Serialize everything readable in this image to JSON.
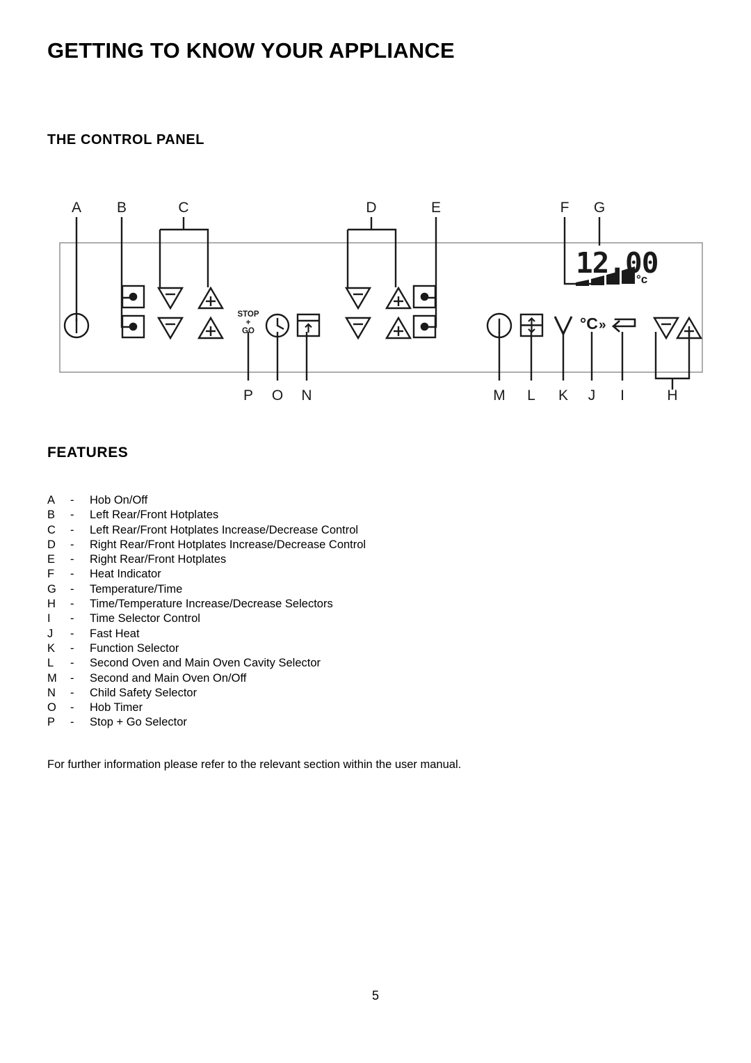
{
  "document": {
    "page_title": "GETTING TO KNOW YOUR APPLIANCE",
    "section_title": "THE CONTROL PANEL",
    "features_title": "FEATURES",
    "footnote": "For further information please refer to the relevant section within the user manual.",
    "page_number": "5"
  },
  "diagram": {
    "top_labels": [
      {
        "letter": "A"
      },
      {
        "letter": "B"
      },
      {
        "letter": "C"
      },
      {
        "letter": "D"
      },
      {
        "letter": "E"
      },
      {
        "letter": "F"
      },
      {
        "letter": "G"
      }
    ],
    "bottom_labels": [
      {
        "letter": "P"
      },
      {
        "letter": "O"
      },
      {
        "letter": "N"
      },
      {
        "letter": "M"
      },
      {
        "letter": "L"
      },
      {
        "letter": "K"
      },
      {
        "letter": "J"
      },
      {
        "letter": "I"
      },
      {
        "letter": "H"
      }
    ],
    "display": {
      "readout": "12.00",
      "unit": "°c",
      "heat_bars": 4
    },
    "stop_go": {
      "line1": "STOP",
      "line2": "+",
      "line3": "GO"
    },
    "symbols": [
      {
        "name": "hob-power-icon",
        "meaning": "Hob On/Off"
      },
      {
        "name": "hotplate-rear-icon",
        "meaning": "Left Rear Hotplate"
      },
      {
        "name": "hotplate-front-icon",
        "meaning": "Left Front Hotplate"
      },
      {
        "name": "decrease-triangle-icon",
        "meaning": "Decrease"
      },
      {
        "name": "increase-triangle-icon",
        "meaning": "Increase"
      },
      {
        "name": "stop-go-icon",
        "meaning": "Stop + Go Selector"
      },
      {
        "name": "clock-icon",
        "meaning": "Hob Timer"
      },
      {
        "name": "child-lock-icon",
        "meaning": "Child Safety Selector"
      },
      {
        "name": "oven-power-icon",
        "meaning": "Second and Main Oven On/Off"
      },
      {
        "name": "oven-cavity-icon",
        "meaning": "Second Oven and Main Oven Cavity Selector"
      },
      {
        "name": "function-chevron-icon",
        "meaning": "Function Selector"
      },
      {
        "name": "fast-heat-icon",
        "meaning": "Fast Heat"
      },
      {
        "name": "time-return-icon",
        "meaning": "Time Selector Control"
      }
    ]
  },
  "features": [
    {
      "key": "A",
      "dash": "-",
      "desc": "Hob On/Off"
    },
    {
      "key": "B",
      "dash": "-",
      "desc": "Left Rear/Front Hotplates"
    },
    {
      "key": "C",
      "dash": "-",
      "desc": "Left Rear/Front Hotplates Increase/Decrease Control"
    },
    {
      "key": "D",
      "dash": "-",
      "desc": "Right Rear/Front Hotplates Increase/Decrease Control"
    },
    {
      "key": "E",
      "dash": "-",
      "desc": "Right Rear/Front Hotplates"
    },
    {
      "key": "F",
      "dash": "-",
      "desc": "Heat Indicator"
    },
    {
      "key": "G",
      "dash": "-",
      "desc": "Temperature/Time"
    },
    {
      "key": "H",
      "dash": "-",
      "desc": "Time/Temperature Increase/Decrease Selectors"
    },
    {
      "key": "I",
      "dash": "-",
      "desc": "Time Selector Control"
    },
    {
      "key": "J",
      "dash": "-",
      "desc": "Fast Heat"
    },
    {
      "key": "K",
      "dash": "-",
      "desc": "Function Selector"
    },
    {
      "key": "L",
      "dash": "-",
      "desc": "Second Oven and Main Oven Cavity Selector"
    },
    {
      "key": "M",
      "dash": "-",
      "desc": "Second and Main Oven On/Off"
    },
    {
      "key": "N",
      "dash": "-",
      "desc": "Child Safety Selector"
    },
    {
      "key": "O",
      "dash": "-",
      "desc": "Hob Timer"
    },
    {
      "key": "P",
      "dash": "-",
      "desc": "Stop + Go Selector"
    }
  ]
}
